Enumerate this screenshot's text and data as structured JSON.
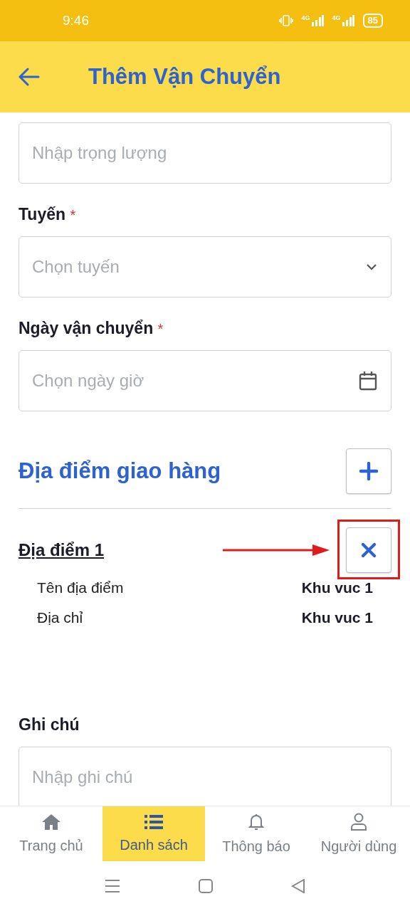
{
  "status_bar": {
    "time": "9:46",
    "networks": [
      {
        "label": "4G"
      },
      {
        "label": "4G"
      }
    ],
    "battery": "85"
  },
  "header": {
    "title": "Thêm Vận Chuyển"
  },
  "fields": [
    {
      "kind": "text",
      "placeholder": "Nhập trọng lượng"
    },
    {
      "kind": "select",
      "label": "Tuyến",
      "marker": "*",
      "placeholder": "Chọn tuyến"
    },
    {
      "kind": "date",
      "label": "Ngày vận chuyển",
      "marker": "*",
      "placeholder": "Chọn ngày giờ"
    }
  ],
  "delivery": {
    "title": "Địa điểm giao hàng",
    "locations": [
      {
        "title": "Địa điểm 1",
        "rows": [
          {
            "label": "Tên địa điểm",
            "value": "Khu vuc 1"
          },
          {
            "label": "Địa chỉ",
            "value": "Khu vuc 1"
          }
        ]
      }
    ]
  },
  "note": {
    "label": "Ghi chú",
    "placeholder": "Nhập ghi chú"
  },
  "bottom_nav": [
    {
      "kind": "home",
      "label": "Trang chủ",
      "selected": false
    },
    {
      "kind": "list",
      "label": "Danh sách",
      "selected": true
    },
    {
      "kind": "bell",
      "label": "Thông báo",
      "selected": false
    },
    {
      "kind": "user",
      "label": "Người dùng",
      "selected": false
    }
  ]
}
